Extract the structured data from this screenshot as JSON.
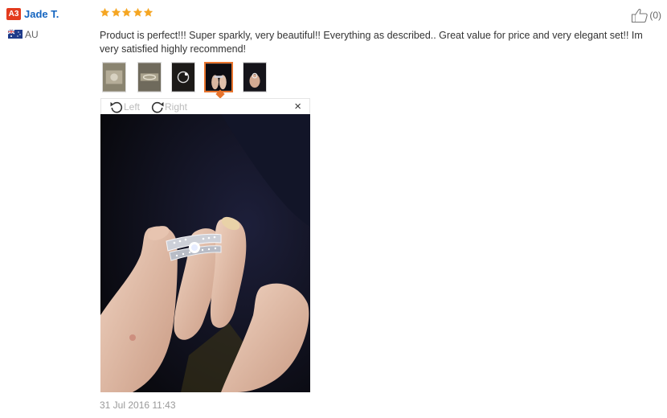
{
  "reviewer": {
    "level": "A3",
    "name": "Jade T.",
    "country": "AU"
  },
  "rating": {
    "stars": 5,
    "max": 5
  },
  "helpful": {
    "count": "(0)"
  },
  "review": {
    "text": "Product is perfect!!! Super sparkly, very beautiful!! Everything as described.. Great value for price and very elegant set!! Im very satisfied highly recommend!",
    "timestamp": "31 Jul 2016 11:43"
  },
  "thumbnails": {
    "count": 5,
    "active_index": 3
  },
  "viewer": {
    "rotate_left_label": "Left",
    "rotate_right_label": "Right",
    "close_label": "×"
  },
  "colors": {
    "star": "#f5a623",
    "name_link": "#1565c0",
    "badge": "#e33b1e",
    "active_thumb_border": "#e8742d"
  }
}
